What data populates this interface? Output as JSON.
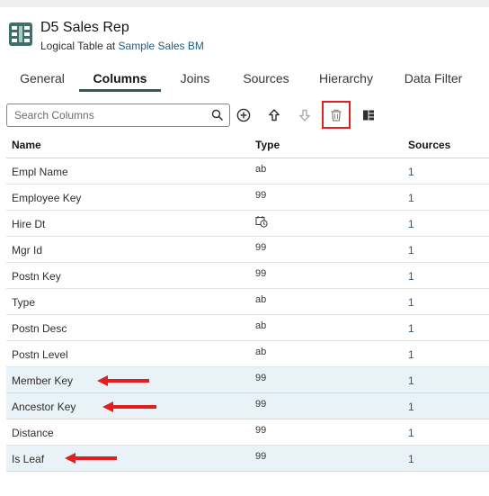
{
  "header": {
    "title": "D5 Sales Rep",
    "subtitle_prefix": "Logical Table at ",
    "subtitle_link": "Sample Sales BM",
    "icon": "logical-table-icon"
  },
  "tabs": [
    {
      "label": "General",
      "active": false
    },
    {
      "label": "Columns",
      "active": true
    },
    {
      "label": "Joins",
      "active": false
    },
    {
      "label": "Sources",
      "active": false
    },
    {
      "label": "Hierarchy",
      "active": false
    },
    {
      "label": "Data Filter",
      "active": false
    }
  ],
  "search": {
    "placeholder": "Search Columns",
    "value": ""
  },
  "toolbar": {
    "icons": [
      "add-circle-icon",
      "move-up-icon",
      "move-down-icon",
      "delete-icon",
      "column-layout-icon"
    ],
    "highlight_color": "#e21e1e"
  },
  "grid": {
    "headers": [
      "Name",
      "Type",
      "Sources"
    ],
    "rows": [
      {
        "name": "Empl Name",
        "type": "ab",
        "sources": "1"
      },
      {
        "name": "Employee Key",
        "type": "99",
        "sources": "1"
      },
      {
        "name": "Hire Dt",
        "type": "",
        "type_icon": "datetime-icon",
        "sources": "1"
      },
      {
        "name": "Mgr Id",
        "type": "99",
        "sources": "1"
      },
      {
        "name": "Postn Key",
        "type": "99",
        "sources": "1"
      },
      {
        "name": "Type",
        "type": "ab",
        "sources": "1"
      },
      {
        "name": "Postn Desc",
        "type": "ab",
        "sources": "1"
      },
      {
        "name": "Postn Level",
        "type": "ab",
        "sources": "1"
      },
      {
        "name": "Member Key",
        "type": "99",
        "sources": "1",
        "selected": true
      },
      {
        "name": "Ancestor Key",
        "type": "99",
        "sources": "1",
        "selected": true
      },
      {
        "name": "Distance",
        "type": "99",
        "sources": "1"
      },
      {
        "name": "Is Leaf",
        "type": "99",
        "sources": "1",
        "selected": true
      }
    ]
  },
  "colors": {
    "accent": "#2e5f47",
    "link": "#1f5c8a",
    "selected_row": "#e8f2f7",
    "annotation_red": "#e21e1e"
  }
}
